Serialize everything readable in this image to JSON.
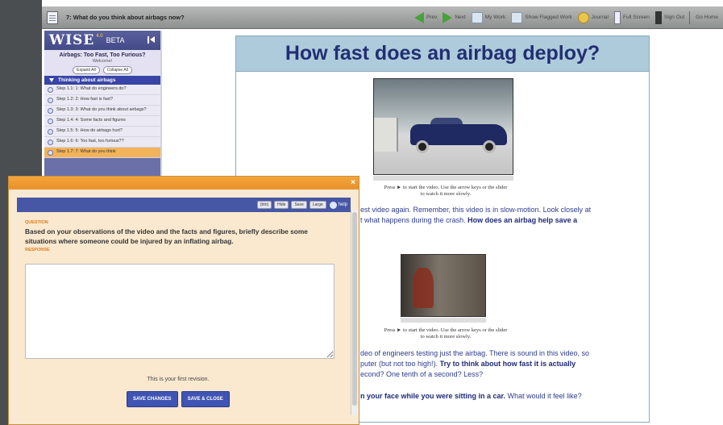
{
  "topbar": {
    "step_title": "7: What do you think about airbags now?",
    "nav": [
      {
        "label": "Prev",
        "icon": "arrow-left-icon"
      },
      {
        "label": "Next",
        "icon": "arrow-right-icon"
      },
      {
        "label": "My Work",
        "icon": "document-icon"
      },
      {
        "label": "Show Flagged Work",
        "icon": "flag-document-icon"
      },
      {
        "label": "Journal",
        "icon": "journal-icon"
      },
      {
        "label": "Full Screen",
        "icon": "full-screen-icon"
      },
      {
        "label": "Sign Out",
        "icon": "sign-out-icon"
      },
      {
        "label": "Go Home",
        "icon": ""
      }
    ]
  },
  "sidebar": {
    "logo": "WISE",
    "version": "4.0",
    "beta": "BETA",
    "project_title": "Airbags: Too Fast, Too Furious?",
    "welcome": "Welcome!",
    "expand_all": "Expand All",
    "collapse_all": "Collapse All",
    "activity": "Thinking about airbags",
    "steps": [
      "Step 1.1: 1: What do engineers do?",
      "Step 1.2: 2: How fast is fast?",
      "Step 1.3: 3: What do you think about airbags?",
      "Step 1.4: 4: Some facts and figures",
      "Step 1.5: 5: How do airbags hurt?",
      "Step 1.6: 6: Too fast, too furious??",
      "Step 1.7: 7: What do you think"
    ]
  },
  "content": {
    "title": "How fast does an airbag deploy?",
    "caption1_a": "Press ► to start the video. Use the arrow keys or the slider",
    "caption1_b": "to watch it more slowly.",
    "para1": "est video again. Remember, this video is in slow-motion. Look closely at",
    "para1b": "t what happens during the crash.",
    "para1_bold": "How does an airbag help save a",
    "caption2_a": "Press ► to start the video. Use the arrow keys or the slider",
    "caption2_b": "to watch it more slowly.",
    "para2_a": "deo of engineers testing just the airbag. There is sound in this video, so",
    "para2_b": "puter (but not too high!).",
    "para2_bold": "Try to think about how fast it is actually",
    "para2_c": "econd? One tenth of a second? Less?",
    "para3_bold": "n your face while you were sitting in a car.",
    "para3": "What would it feel like?"
  },
  "popup": {
    "toolbar_buttons": [
      "(btn)",
      "Hide",
      "Save",
      "Large"
    ],
    "help": "help",
    "question_label": "QUESTION",
    "question": "Based on your observations of the video and the facts and figures, briefly describe some situations where someone could be injured by an inflating airbag.",
    "response_label": "RESPONSE",
    "response_value": "",
    "revision_note": "This is your first revision.",
    "save_changes": "SAVE CHANGES",
    "save_close": "SAVE & CLOSE"
  }
}
